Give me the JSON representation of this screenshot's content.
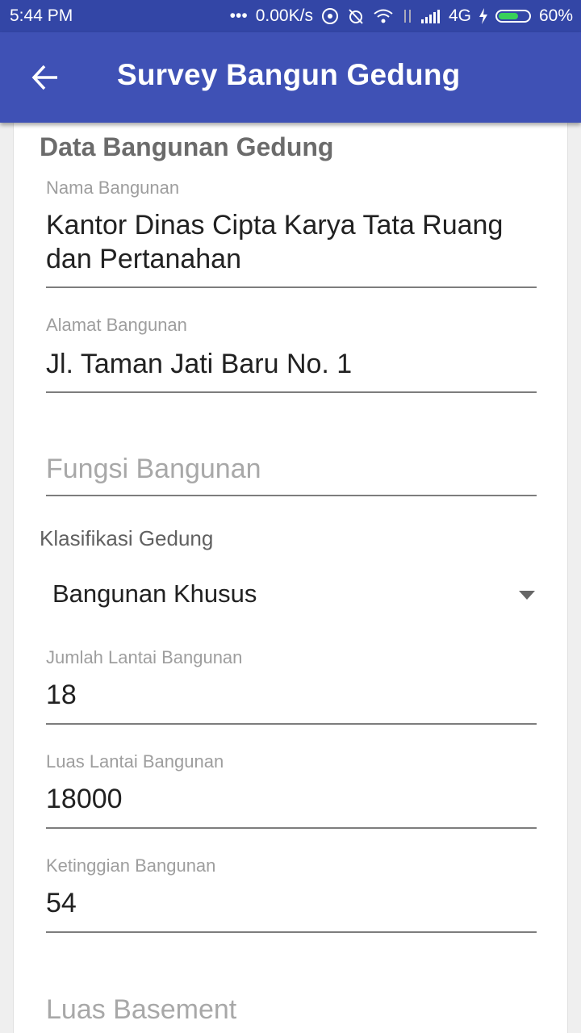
{
  "status_bar": {
    "time": "5:44 PM",
    "dots": "•••",
    "speed": "0.00K/s",
    "network": "4G",
    "battery": "60%"
  },
  "app_bar": {
    "title": "Survey Bangun Gedung",
    "back_icon": "arrow-left-icon"
  },
  "form": {
    "section_title": "Data Bangunan Gedung",
    "nama_bangunan": {
      "label": "Nama Bangunan",
      "value": "Kantor Dinas Cipta Karya Tata Ruang dan Pertanahan"
    },
    "alamat_bangunan": {
      "label": "Alamat Bangunan",
      "value": "Jl. Taman Jati Baru No. 1"
    },
    "fungsi_bangunan": {
      "placeholder": "Fungsi Bangunan"
    },
    "klasifikasi": {
      "label": "Klasifikasi Gedung",
      "value": "Bangunan Khusus"
    },
    "jumlah_lantai": {
      "label": "Jumlah Lantai Bangunan",
      "value": "18"
    },
    "luas_lantai": {
      "label": "Luas Lantai Bangunan",
      "value": "18000"
    },
    "ketinggian": {
      "label": "Ketinggian Bangunan",
      "value": "54"
    },
    "luas_basement": {
      "placeholder": "Luas Basement"
    }
  },
  "colors": {
    "status_bar": "#3346a6",
    "app_bar": "#3f51b5",
    "battery_fill": "#39d15a"
  }
}
